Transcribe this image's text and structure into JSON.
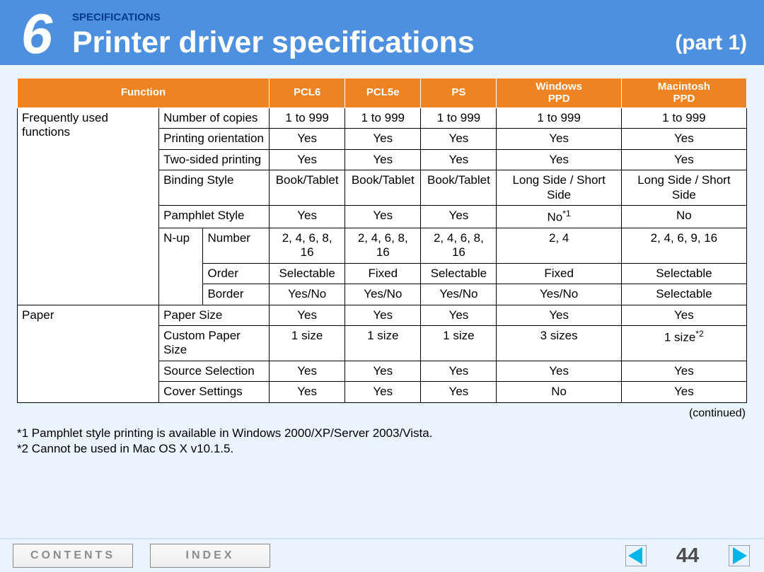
{
  "header": {
    "chapter_number": "6",
    "kicker": "SPECIFICATIONS",
    "title": "Printer driver specifications",
    "part": "(part 1)"
  },
  "table": {
    "headers": [
      "Function",
      "PCL6",
      "PCL5e",
      "PS",
      "Windows\nPPD",
      "Macintosh\nPPD"
    ],
    "rows": [
      {
        "group": "Frequently used functions",
        "func": "Number of copies",
        "sub": "",
        "v": [
          "1 to 999",
          "1 to 999",
          "1 to 999",
          "1 to 999",
          "1 to 999"
        ]
      },
      {
        "group": "",
        "func": "Printing orientation",
        "sub": "",
        "v": [
          "Yes",
          "Yes",
          "Yes",
          "Yes",
          "Yes"
        ]
      },
      {
        "group": "",
        "func": "Two-sided printing",
        "sub": "",
        "v": [
          "Yes",
          "Yes",
          "Yes",
          "Yes",
          "Yes"
        ]
      },
      {
        "group": "",
        "func": "Binding Style",
        "sub": "",
        "v": [
          "Book/Tablet",
          "Book/Tablet",
          "Book/Tablet",
          "Long Side / Short Side",
          "Long Side / Short Side"
        ]
      },
      {
        "group": "",
        "func": "Pamphlet Style",
        "sub": "",
        "v": [
          "Yes",
          "Yes",
          "Yes",
          "No*1",
          "No"
        ]
      },
      {
        "group": "",
        "func": "N-up",
        "sub": "Number",
        "v": [
          "2, 4, 6, 8, 16",
          "2, 4, 6, 8, 16",
          "2, 4, 6, 8, 16",
          "2, 4",
          "2, 4, 6, 9, 16"
        ]
      },
      {
        "group": "",
        "func": "",
        "sub": "Order",
        "v": [
          "Selectable",
          "Fixed",
          "Selectable",
          "Fixed",
          "Selectable"
        ]
      },
      {
        "group": "",
        "func": "",
        "sub": "Border",
        "v": [
          "Yes/No",
          "Yes/No",
          "Yes/No",
          "Yes/No",
          "Selectable"
        ]
      },
      {
        "group": "Paper",
        "func": "Paper Size",
        "sub": "",
        "v": [
          "Yes",
          "Yes",
          "Yes",
          "Yes",
          "Yes"
        ]
      },
      {
        "group": "",
        "func": "Custom Paper Size",
        "sub": "",
        "v": [
          "1 size",
          "1 size",
          "1 size",
          "3 sizes",
          "1 size*2"
        ]
      },
      {
        "group": "",
        "func": "Source Selection",
        "sub": "",
        "v": [
          "Yes",
          "Yes",
          "Yes",
          "Yes",
          "Yes"
        ]
      },
      {
        "group": "",
        "func": "Cover Settings",
        "sub": "",
        "v": [
          "Yes",
          "Yes",
          "Yes",
          "No",
          "Yes"
        ]
      }
    ]
  },
  "continued": "(continued)",
  "footnotes": [
    "*1 Pamphlet style printing is available in Windows 2000/XP/Server 2003/Vista.",
    "*2 Cannot be used in Mac OS X v10.1.5."
  ],
  "footer": {
    "contents": "CONTENTS",
    "index": "INDEX",
    "page": "44"
  }
}
